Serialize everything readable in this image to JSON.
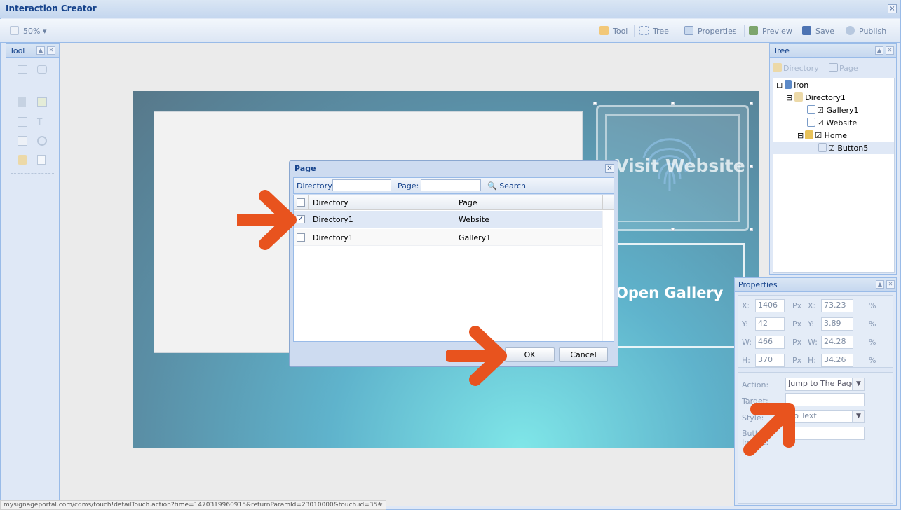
{
  "window": {
    "title": "Interaction Creator",
    "close": "×"
  },
  "toolbar": {
    "zoom": "50%",
    "items": [
      "Tool",
      "Tree",
      "Properties",
      "Preview",
      "Save",
      "Publish"
    ]
  },
  "tool_panel": {
    "title": "Tool"
  },
  "stage": {
    "visit_button_text": "Visit Website",
    "gallery_button_text": "Open Gallery"
  },
  "tree_panel": {
    "title": "Tree",
    "buttons": [
      "Directory",
      "Page"
    ],
    "nodes": [
      "iron",
      "Directory1",
      "Gallery1",
      "Website",
      "Home",
      "Button5"
    ]
  },
  "dialog": {
    "title": "Page",
    "directory_label": "Directory:",
    "page_label": "Page:",
    "search_label": "Search",
    "columns": [
      "Directory",
      "Page"
    ],
    "rows": [
      {
        "directory": "Directory1",
        "page": "Website",
        "checked": true
      },
      {
        "directory": "Directory1",
        "page": "Gallery1",
        "checked": false
      }
    ],
    "ok": "OK",
    "cancel": "Cancel"
  },
  "properties": {
    "title": "Properties",
    "fields": [
      {
        "label": "X:",
        "px": "1406",
        "pct": "73.23"
      },
      {
        "label": "Y:",
        "px": "42",
        "pct": "3.89"
      },
      {
        "label": "W:",
        "px": "466",
        "pct": "24.28"
      },
      {
        "label": "H:",
        "px": "370",
        "pct": "34.26"
      }
    ],
    "unit_px": "Px",
    "unit_pct": "%",
    "action_label": "Action:",
    "action_value": "Jump to The Page",
    "target_label": "Target:",
    "style_label": "Style:",
    "style_value": "No Text",
    "button_image_label_1": "Button",
    "button_image_label_2": "Image:"
  },
  "status": {
    "url": "mysignageportal.com/cdms/touch!detailTouch.action?time=1470319960915&returnParamId=23010000&touch.id=35#"
  },
  "colors": {
    "accent_arrow": "#e8531e",
    "header_blue": "#15428b",
    "panel_bg": "#dfe8f6"
  }
}
